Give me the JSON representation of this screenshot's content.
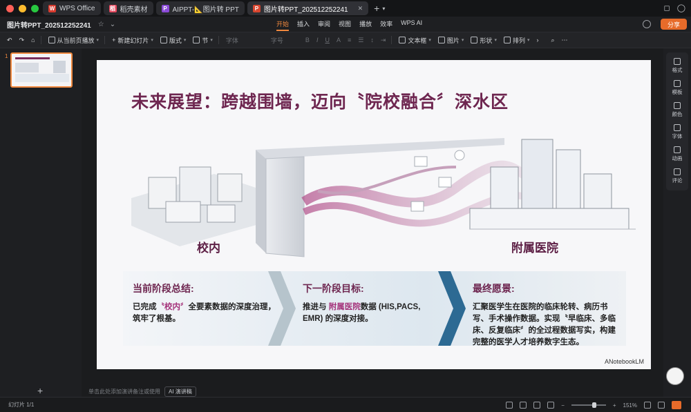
{
  "tabs": [
    {
      "label": "WPS Office",
      "badge": "W",
      "color": "#d83b2f"
    },
    {
      "label": "稻壳素材",
      "badge": "稻",
      "color": "#e5465c"
    },
    {
      "label": "AIPPT-📐图片转 PPT",
      "badge": "P",
      "color": "#8b4bd8"
    },
    {
      "label": "图片转PPT_202512252241",
      "badge": "P",
      "color": "#d8462f",
      "active": true
    }
  ],
  "document": {
    "name": "图片转PPT_202512252241"
  },
  "menus": [
    "开始",
    "插入",
    "审阅",
    "视图",
    "播放",
    "效率",
    "WPS AI"
  ],
  "share_label": "分享",
  "toolbar": {
    "from_current": "从当前页播放",
    "new_slide": "新建幻灯片",
    "layout": "版式",
    "section": "节",
    "font": "字体",
    "font_size": "字号",
    "textbox": "文本框",
    "image": "图片",
    "shape": "形状",
    "arrange": "排列"
  },
  "thumbnail": {
    "number": "1"
  },
  "slide": {
    "title": "未来展望：跨越围墙，迈向〝院校融合〞深水区",
    "label_left": "校内",
    "label_right": "附属医院",
    "col1": {
      "heading": "当前阶段总结:",
      "pre": "已完成",
      "hl": "〝校内〞",
      "post": "全要素数据的深度治理，筑牢了根基。"
    },
    "col2": {
      "heading": "下一阶段目标:",
      "pre": "推进与 ",
      "hl": "附属医院",
      "post": "数据 (HIS,PACS, EMR) 的深度对接。"
    },
    "col3": {
      "heading": "最终愿景:",
      "body": "汇聚医学生在医院的临床轮转、病历书写、手术操作数据。实现〝早临床、多临床、反复临床〞的全过程数据写实，构建完整的医学人才培养数字生态。"
    },
    "footer": "ANotebookLM"
  },
  "notes": {
    "placeholder": "单击此处添加演讲备注或使用",
    "ai_button": "AI 演讲稿"
  },
  "sidebar": [
    "格式",
    "模板",
    "颜色",
    "字体",
    "动画",
    "评论"
  ],
  "status": {
    "slide_count": "幻灯片 1/1",
    "zoom": "151%"
  }
}
